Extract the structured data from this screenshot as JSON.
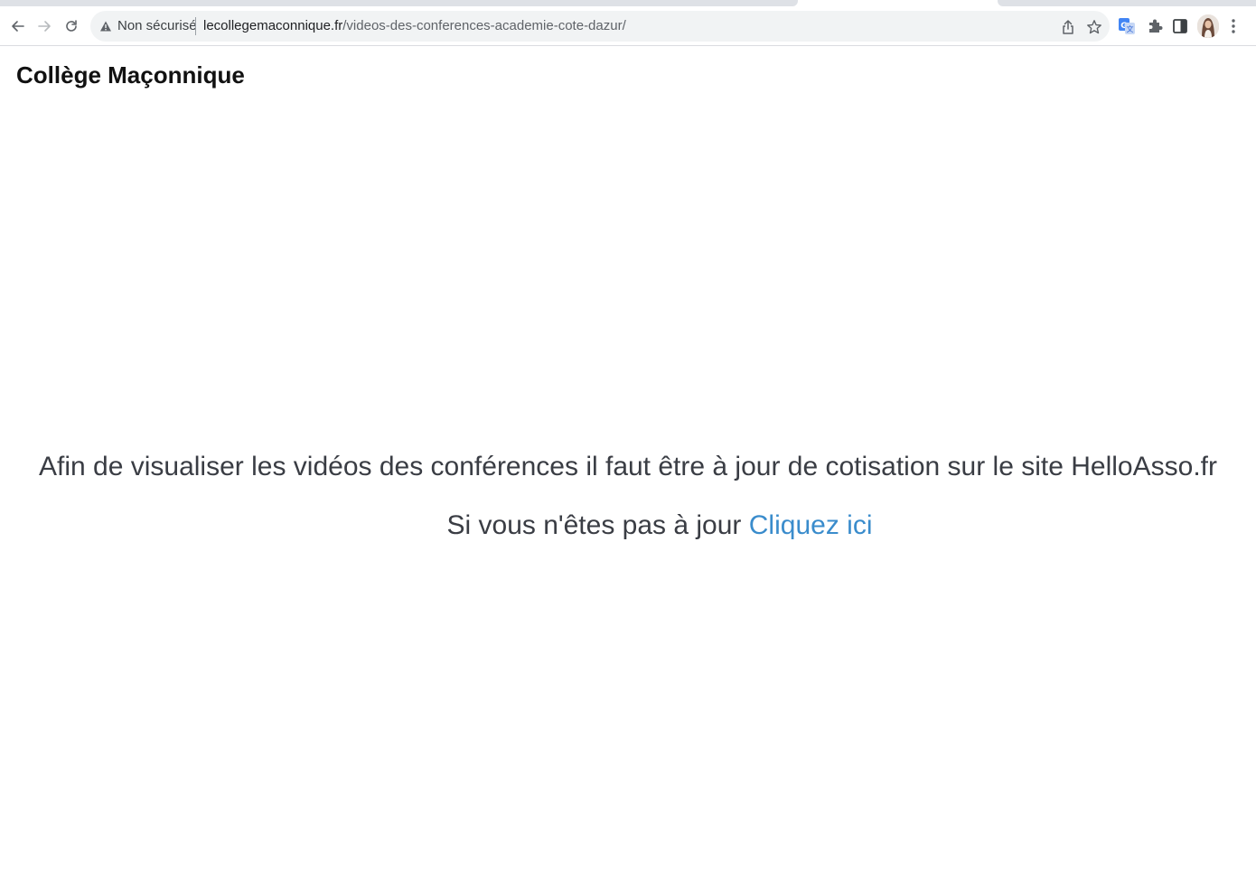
{
  "browser": {
    "security_label": "Non sécurisé",
    "url_domain": "lecollegemaconnique.fr",
    "url_path": "/videos-des-conferences-academie-cote-dazur/",
    "icons": {
      "back": "back-arrow-icon",
      "forward": "forward-arrow-icon",
      "reload": "reload-icon",
      "warning": "warning-triangle-icon",
      "share": "share-icon",
      "bookmark": "star-icon",
      "translate": "google-translate-icon",
      "extensions": "puzzle-icon",
      "side_panel": "side-panel-icon",
      "profile": "avatar",
      "menu": "kebab-menu-icon"
    }
  },
  "page": {
    "site_title": "Collège Maçonnique",
    "message": "Afin de visualiser les vidéos des conférences il faut être à jour de cotisation sur le site HelloAsso.fr",
    "subline_prefix": "Si vous n'êtes pas à jour",
    "link_label": "Cliquez ici"
  },
  "colors": {
    "text": "#3a3d44",
    "link": "#3a8ccc",
    "omnibox_bg": "#f1f3f4"
  }
}
